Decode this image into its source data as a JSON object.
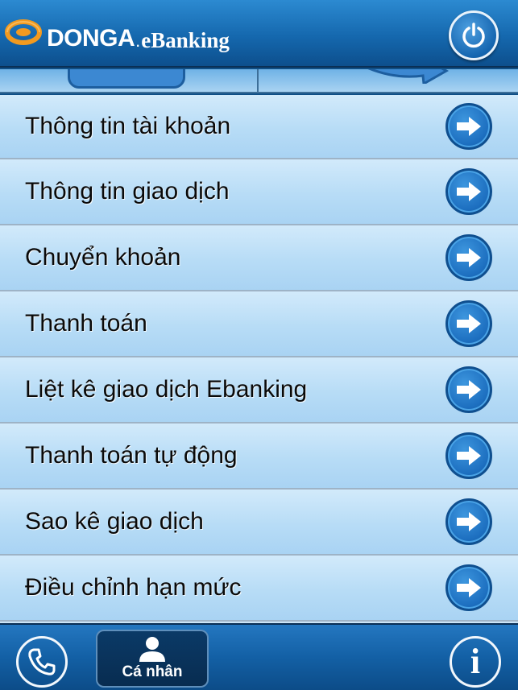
{
  "header": {
    "brand_main": "DONGA",
    "brand_dot": ".",
    "brand_sub": "eBanking",
    "icons": {
      "logo": "donga-logo-icon",
      "power": "power-icon"
    }
  },
  "menu": {
    "items": [
      {
        "label": "Thông tin tài khoản",
        "icon": "arrow-right-circle-icon"
      },
      {
        "label": "Thông tin giao dịch",
        "icon": "arrow-right-circle-icon"
      },
      {
        "label": "Chuyển khoản",
        "icon": "arrow-right-circle-icon"
      },
      {
        "label": "Thanh toán",
        "icon": "arrow-right-circle-icon"
      },
      {
        "label": "Liệt kê giao dịch Ebanking",
        "icon": "arrow-right-circle-icon"
      },
      {
        "label": "Thanh toán tự động",
        "icon": "arrow-right-circle-icon"
      },
      {
        "label": "Sao kê giao dịch",
        "icon": "arrow-right-circle-icon"
      },
      {
        "label": "Điều chỉnh hạn mức",
        "icon": "arrow-right-circle-icon"
      }
    ]
  },
  "tabbar": {
    "profile_label": "Cá nhân",
    "info_glyph": "i",
    "icons": {
      "phone": "phone-icon",
      "profile": "person-icon",
      "info": "info-icon"
    }
  },
  "colors": {
    "brand_blue": "#1568ae",
    "menu_bg": "#b7dcf6",
    "arrow_blue": "#1d6fc0",
    "logo_orange": "#f29a1f"
  }
}
